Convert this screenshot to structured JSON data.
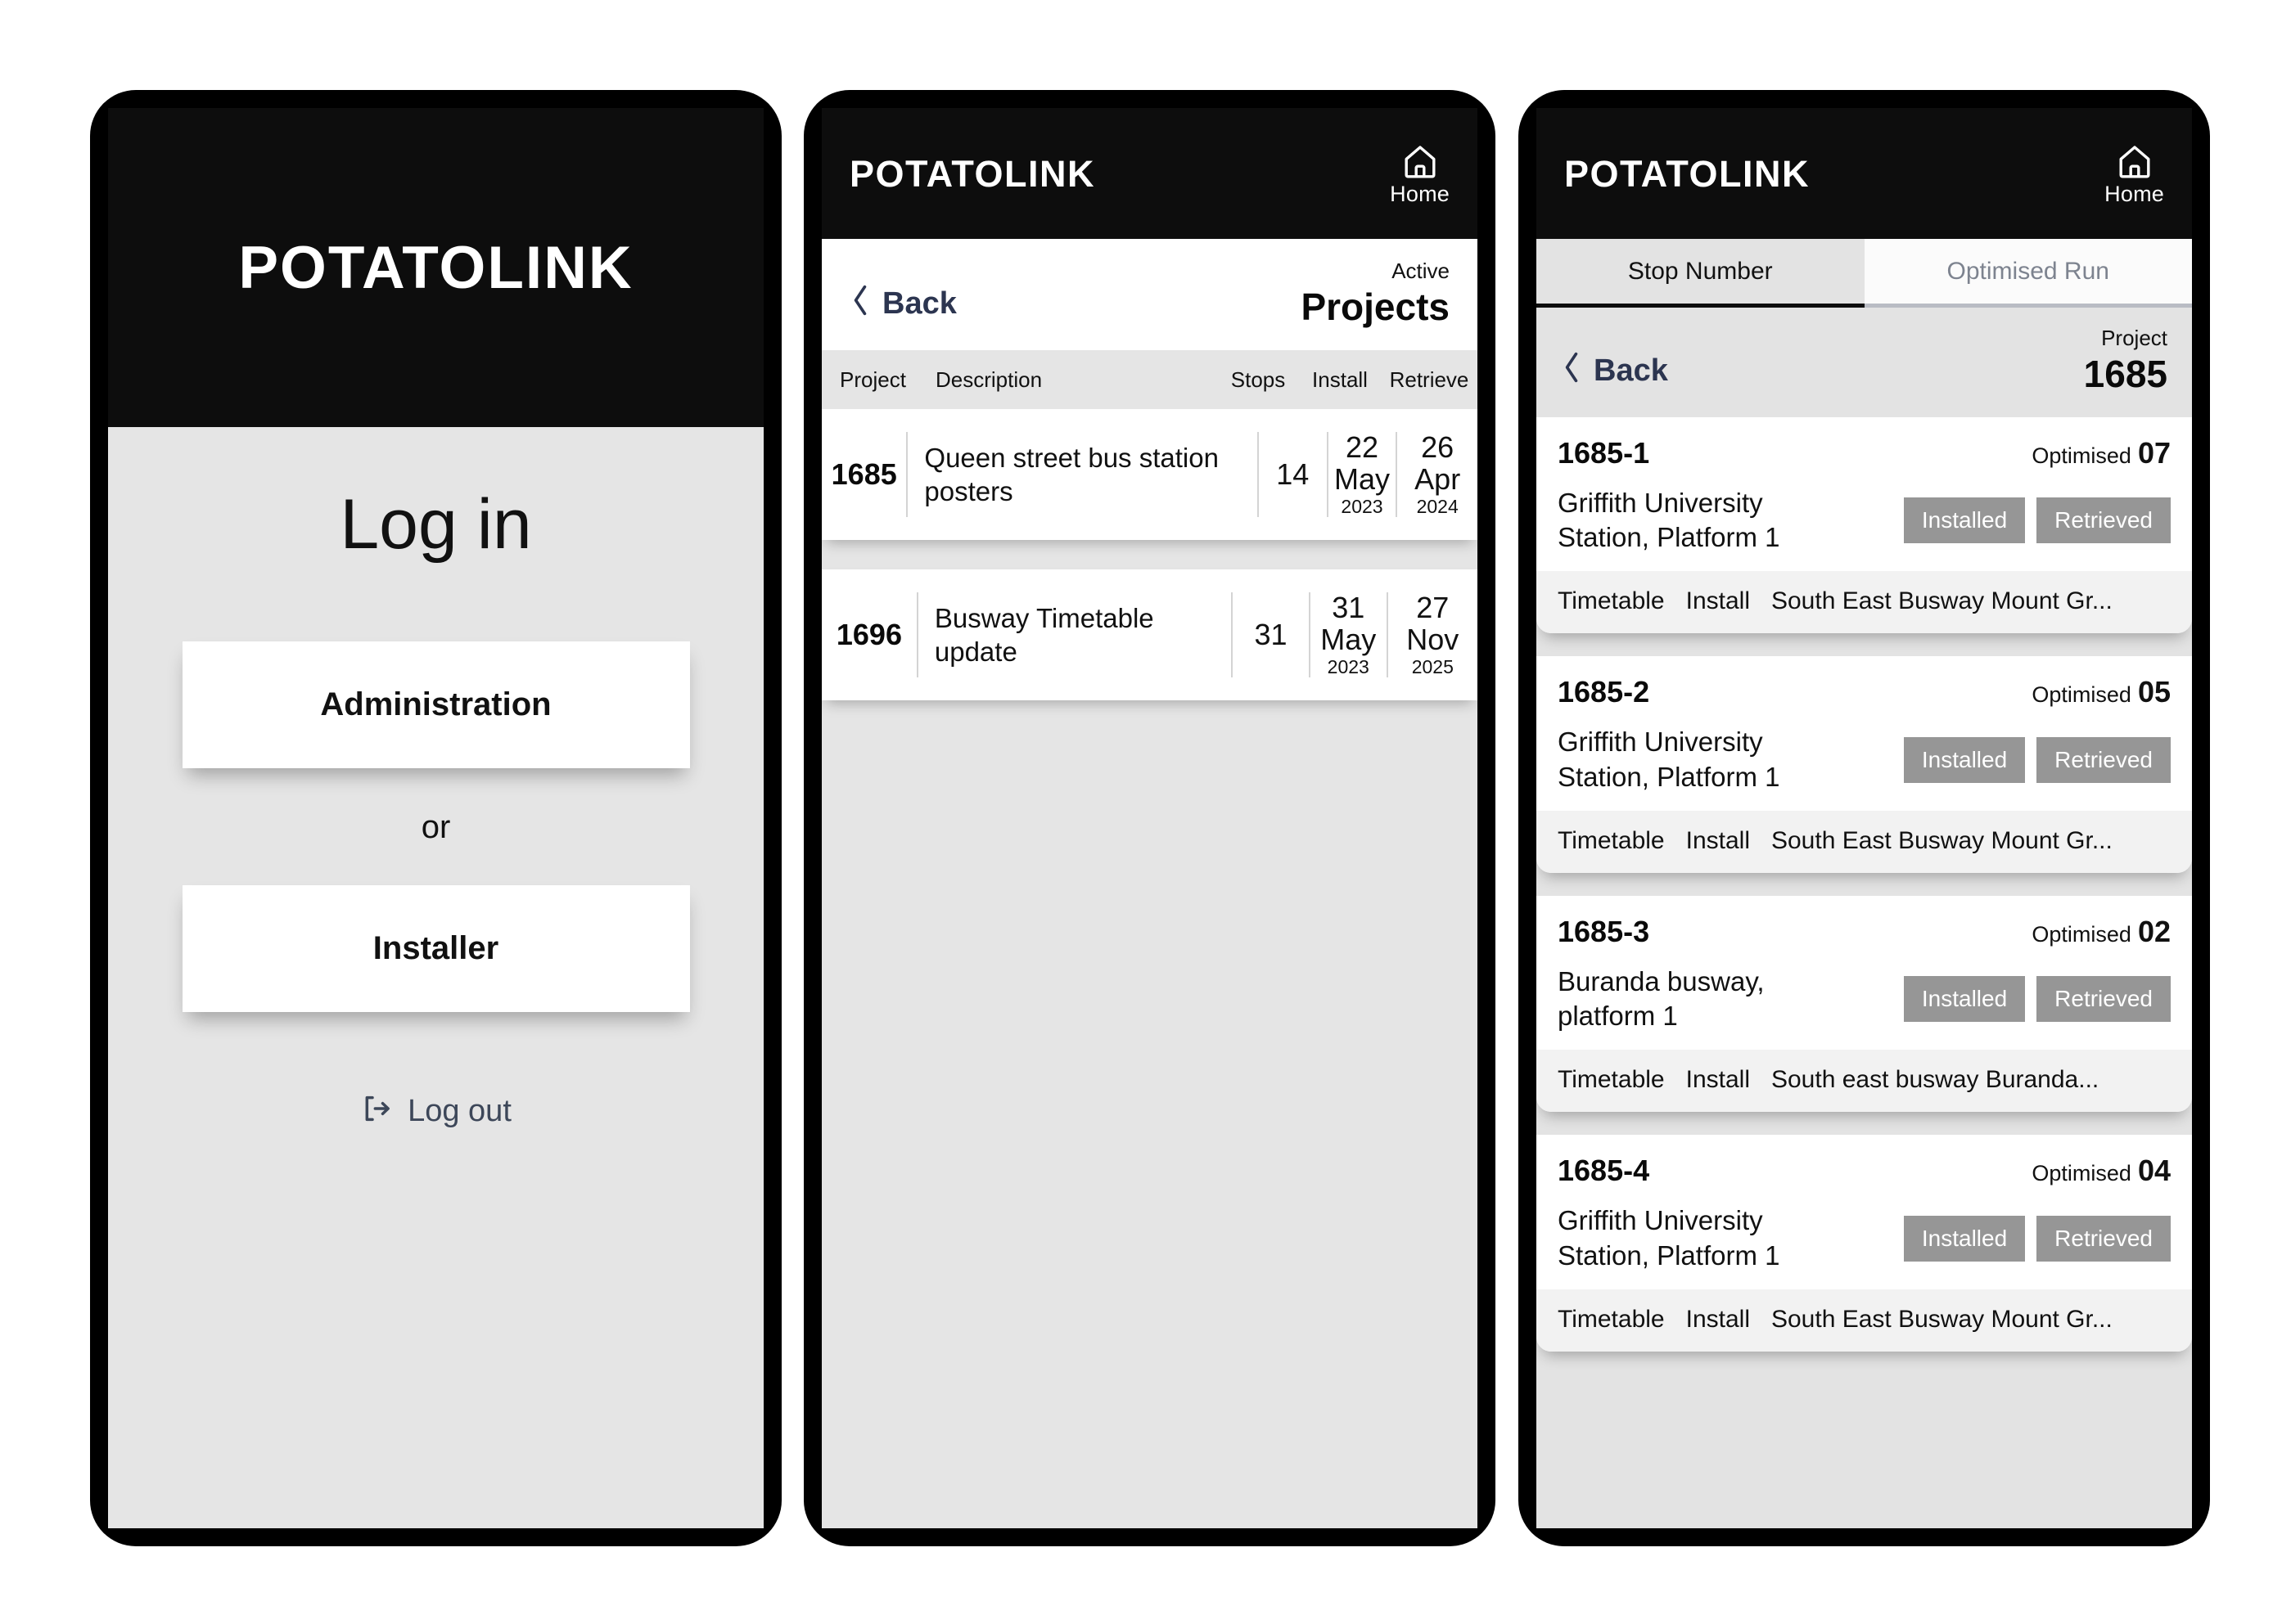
{
  "brand": "POTATOLINK",
  "colors": {
    "bezel": "#000000",
    "appbar": "#0d0d0d",
    "screen_bg": "#e5e5e5",
    "card": "#ffffff",
    "link": "#2c3550",
    "pill": "#969696",
    "tab_inactive_text": "#7d838f"
  },
  "home": {
    "label": "Home",
    "icon": "home-icon"
  },
  "login": {
    "title": "Log in",
    "admin_label": "Administration",
    "or_label": "or",
    "installer_label": "Installer",
    "logout_label": "Log out",
    "logout_icon": "logout-icon"
  },
  "projects": {
    "back_label": "Back",
    "back_icon": "chevron-left-icon",
    "eyebrow": "Active",
    "title": "Projects",
    "columns": {
      "project": "Project",
      "description": "Description",
      "stops": "Stops",
      "install": "Install",
      "retrieve": "Retrieve"
    },
    "rows": [
      {
        "project": "1685",
        "description": "Queen street bus station posters",
        "stops": "14",
        "install": {
          "day": "22",
          "month": "May",
          "year": "2023"
        },
        "retrieve": {
          "day": "26",
          "month": "Apr",
          "year": "2024"
        }
      },
      {
        "project": "1696",
        "description": "Busway Timetable update",
        "stops": "31",
        "install": {
          "day": "31",
          "month": "May",
          "year": "2023"
        },
        "retrieve": {
          "day": "27",
          "month": "Nov",
          "year": "2025"
        }
      }
    ]
  },
  "stops": {
    "tabs": [
      {
        "label": "Stop Number",
        "active": true
      },
      {
        "label": "Optimised Run",
        "active": false
      }
    ],
    "back_label": "Back",
    "back_icon": "chevron-left-icon",
    "eyebrow": "Project",
    "title": "1685",
    "optimised_label": "Optimised",
    "installed_label": "Installed",
    "retrieved_label": "Retrieved",
    "cards": [
      {
        "id": "1685-1",
        "optimised": "07",
        "location": "Griffith University Station, Platform 1",
        "foot_type": "Timetable",
        "foot_action": "Install",
        "foot_name": "South East Busway Mount Gr..."
      },
      {
        "id": "1685-2",
        "optimised": "05",
        "location": "Griffith University Station, Platform 1",
        "foot_type": "Timetable",
        "foot_action": "Install",
        "foot_name": "South East Busway Mount Gr..."
      },
      {
        "id": "1685-3",
        "optimised": "02",
        "location": "Buranda busway, platform 1",
        "foot_type": "Timetable",
        "foot_action": "Install",
        "foot_name": "South east busway Buranda..."
      },
      {
        "id": "1685-4",
        "optimised": "04",
        "location": "Griffith University Station, Platform 1",
        "foot_type": "Timetable",
        "foot_action": "Install",
        "foot_name": "South East Busway Mount Gr..."
      }
    ]
  }
}
